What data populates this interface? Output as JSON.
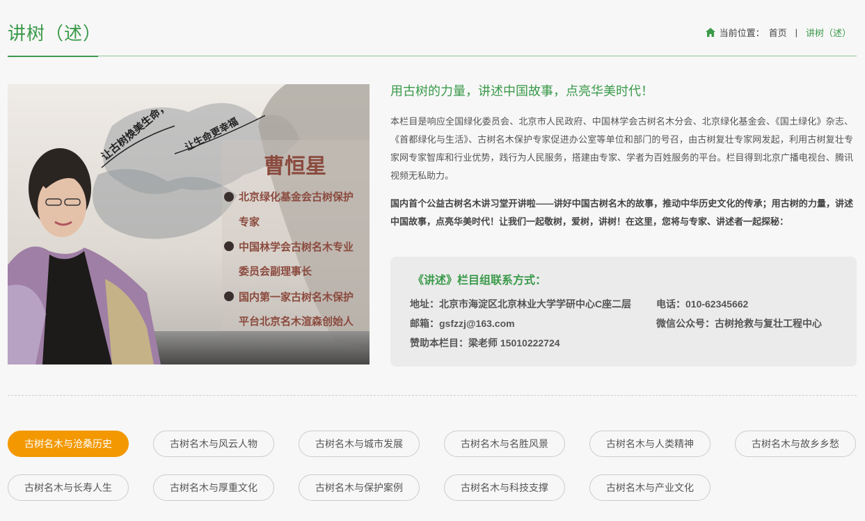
{
  "header": {
    "title": "讲树（述）",
    "breadcrumb": {
      "prefix": "当前位置：",
      "home": "首页",
      "separator": "|",
      "current": "讲树（述）"
    }
  },
  "photo": {
    "slogan_left": "让古树焕美生命，",
    "slogan_right": "让生命更幸福",
    "name": "曹恒星",
    "titles": [
      "北京绿化基金会古树保护",
      "专家",
      "中国林学会古树名木专业",
      "委员会副理事长",
      "国内第一家古树名木保护",
      "平台北京名木渲森创始人"
    ]
  },
  "intro": {
    "slogan": "用古树的力量，讲述中国故事，点亮华美时代！",
    "paragraph1": "本栏目是响应全国绿化委员会、北京市人民政府、中国林学会古树名木分会、北京绿化基金会、《国土绿化》杂志、《首都绿化与生活》、古树名木保护专家促进办公室等单位和部门的号召，由古树复壮专家网发起，利用古树复壮专家网专家智库和行业优势，践行为人民服务，搭建由专家、学者为百姓服务的平台。栏目得到北京广播电视台、腾讯视频无私助力。",
    "paragraph2": "国内首个公益古树名木讲习堂开讲啦——讲好中国古树名木的故事，推动中华历史文化的传承；用古树的力量，讲述中国故事，点亮华美时代！让我们一起敬树，爱树，讲树！在这里，您将与专家、讲述者一起探秘："
  },
  "contact": {
    "title": "《讲述》栏目组联系方式：",
    "address": "地址：北京市海淀区北京林业大学学研中心C座二层",
    "phone": "电话：010-62345662",
    "email": "邮箱：gsfzzj@163.com",
    "wechat": "微信公众号：古树抢救与复壮工程中心",
    "sponsor": "赞助本栏目：梁老师 15010222724"
  },
  "tags": [
    {
      "label": "古树名木与沧桑历史",
      "active": true
    },
    {
      "label": "古树名木与风云人物",
      "active": false
    },
    {
      "label": "古树名木与城市发展",
      "active": false
    },
    {
      "label": "古树名木与名胜风景",
      "active": false
    },
    {
      "label": "古树名木与人类精神",
      "active": false
    },
    {
      "label": "古树名木与故乡乡愁",
      "active": false
    },
    {
      "label": "古树名木与长寿人生",
      "active": false
    },
    {
      "label": "古树名木与厚重文化",
      "active": false
    },
    {
      "label": "古树名木与保护案例",
      "active": false
    },
    {
      "label": "古树名木与科技支撑",
      "active": false
    },
    {
      "label": "古树名木与产业文化",
      "active": false
    }
  ],
  "colors": {
    "accent_green": "#3a9a4a",
    "active_orange": "#f39800"
  }
}
